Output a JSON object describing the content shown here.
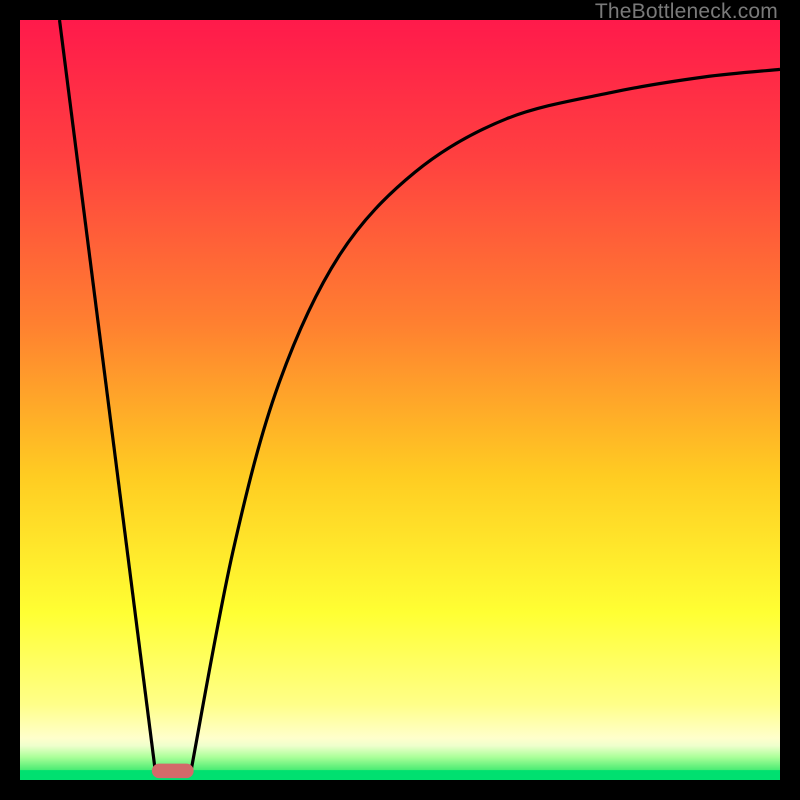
{
  "watermark": "TheBottleneck.com",
  "chart_data": {
    "type": "line",
    "title": "",
    "xlabel": "",
    "ylabel": "",
    "xlim": [
      0,
      1
    ],
    "ylim": [
      0,
      1
    ],
    "background_gradient": {
      "stops": [
        {
          "offset": 0.0,
          "color": "#ff1a4b"
        },
        {
          "offset": 0.18,
          "color": "#ff4040"
        },
        {
          "offset": 0.4,
          "color": "#ff8030"
        },
        {
          "offset": 0.6,
          "color": "#ffcc22"
        },
        {
          "offset": 0.78,
          "color": "#ffff33"
        },
        {
          "offset": 0.9,
          "color": "#ffff88"
        },
        {
          "offset": 0.945,
          "color": "#ffffcc"
        },
        {
          "offset": 0.955,
          "color": "#eeffcc"
        },
        {
          "offset": 0.97,
          "color": "#aaff99"
        },
        {
          "offset": 0.985,
          "color": "#55ee77"
        },
        {
          "offset": 1.0,
          "color": "#00e070"
        }
      ]
    },
    "series": [
      {
        "name": "left-line",
        "type": "segment",
        "x": [
          0.052,
          0.178
        ],
        "y": [
          1.0,
          0.012
        ]
      },
      {
        "name": "right-curve",
        "type": "curve",
        "x": [
          0.225,
          0.28,
          0.34,
          0.42,
          0.52,
          0.64,
          0.78,
          0.9,
          1.0
        ],
        "y": [
          0.012,
          0.3,
          0.52,
          0.69,
          0.8,
          0.87,
          0.905,
          0.925,
          0.935
        ]
      }
    ],
    "bottom_band": {
      "color": "#00e070",
      "y_top": 0.987,
      "y_bottom": 1.0
    },
    "marker": {
      "shape": "pill",
      "center_x": 0.201,
      "y": 0.012,
      "width": 0.055,
      "height": 0.019,
      "color": "#d36a6a"
    }
  }
}
